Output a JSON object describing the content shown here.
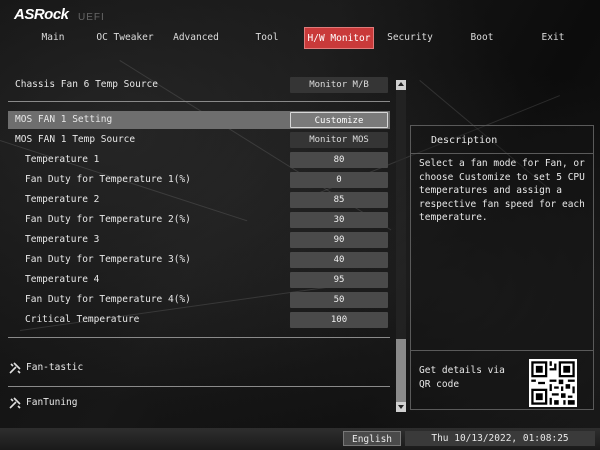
{
  "brand": {
    "logo": "ASRock",
    "sub": "UEFI"
  },
  "tabs": [
    {
      "label": "Main"
    },
    {
      "label": "OC Tweaker"
    },
    {
      "label": "Advanced"
    },
    {
      "label": "Tool"
    },
    {
      "label": "H/W Monitor",
      "active": true
    },
    {
      "label": "Security"
    },
    {
      "label": "Boot"
    },
    {
      "label": "Exit"
    }
  ],
  "settings": {
    "chassis_fan6_source": {
      "label": "Chassis Fan 6 Temp Source",
      "value": "Monitor M/B"
    },
    "mos_fan1_setting": {
      "label": "MOS FAN 1 Setting",
      "value": "Customize"
    },
    "mos_fan1_source": {
      "label": "MOS FAN 1 Temp Source",
      "value": "Monitor MOS"
    },
    "temp1": {
      "label": "Temperature 1",
      "value": "80"
    },
    "duty1": {
      "label": "Fan Duty for Temperature 1(%)",
      "value": "0"
    },
    "temp2": {
      "label": "Temperature 2",
      "value": "85"
    },
    "duty2": {
      "label": "Fan Duty for Temperature 2(%)",
      "value": "30"
    },
    "temp3": {
      "label": "Temperature 3",
      "value": "90"
    },
    "duty3": {
      "label": "Fan Duty for Temperature 3(%)",
      "value": "40"
    },
    "temp4": {
      "label": "Temperature 4",
      "value": "95"
    },
    "duty4": {
      "label": "Fan Duty for Temperature 4(%)",
      "value": "50"
    },
    "critical": {
      "label": "Critical Temperature",
      "value": "100"
    }
  },
  "tools": {
    "fantastic": "Fan-tastic",
    "fantuning": "FanTuning"
  },
  "description": {
    "title": "Description",
    "text": "Select a fan mode for Fan, or choose Customize to set 5 CPU temperatures and assign a respective fan speed for each temperature.",
    "qr_text": "Get details via QR code"
  },
  "status": {
    "language": "English",
    "datetime": "Thu 10/13/2022, 01:08:25"
  },
  "colors": {
    "accent": "#c93a3a",
    "selected_row": "#6e6e6e",
    "value_box": "#4a4a4a"
  }
}
